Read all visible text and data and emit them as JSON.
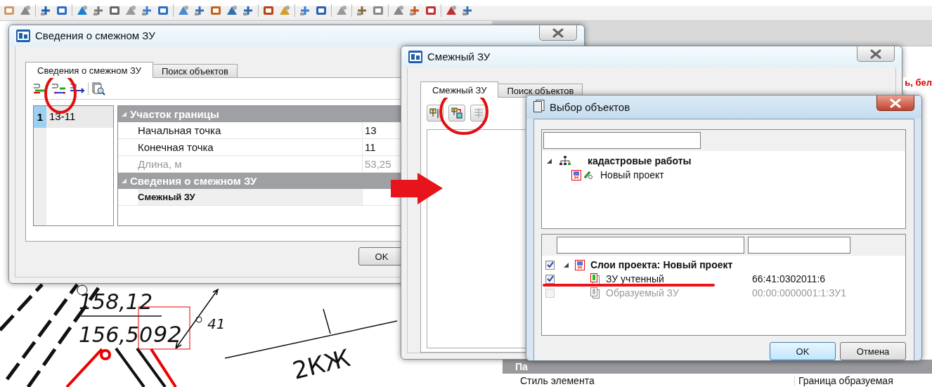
{
  "canvas": {
    "labels": [
      {
        "text": "158,12"
      },
      {
        "text": "156,50"
      },
      {
        "text": "92"
      },
      {
        "text": "41"
      },
      {
        "text": "2КЖ"
      }
    ]
  },
  "side_panel": {
    "warning": "ь, бел",
    "section_title": "Па",
    "property_name": "Стиль элемента",
    "property_value": "Граница образуемая"
  },
  "boundary_window": {
    "title": "Сведения о смежном ЗУ",
    "tabs": [
      {
        "label": "Сведения о смежном ЗУ",
        "selected": true
      },
      {
        "label": "Поиск объектов",
        "selected": false
      }
    ],
    "segments": [
      {
        "index": "1",
        "name": "13-11",
        "selected": true
      }
    ],
    "groups": [
      {
        "title": "Участок границы",
        "expanded": true,
        "rows": [
          {
            "label": "Начальная точка",
            "value": "13",
            "disabled": false,
            "bold": false
          },
          {
            "label": "Конечная точка",
            "value": "11",
            "disabled": false,
            "bold": false
          },
          {
            "label": "Длина, м",
            "value": "53,25",
            "disabled": true,
            "bold": false
          }
        ]
      },
      {
        "title": "Сведения о смежном ЗУ",
        "expanded": true,
        "rows": [
          {
            "label": "Смежный ЗУ",
            "disabled": false,
            "bold": true
          }
        ]
      }
    ],
    "ok_button": "OK"
  },
  "parcel_window": {
    "title": "Смежный ЗУ",
    "tabs": [
      {
        "label": "Смежный ЗУ",
        "selected": true
      },
      {
        "label": "Поиск объектов",
        "selected": false
      }
    ]
  },
  "picker_window": {
    "title": "Выбор объектов",
    "tree": [
      {
        "label": "кадастровые работы",
        "expanded": true,
        "children": [
          {
            "label": "Новый проект"
          }
        ]
      }
    ],
    "layers": [
      {
        "label": "Слои проекта: Новый проект",
        "checked": true,
        "disabled": false,
        "expanded": true,
        "children": [
          {
            "label": "ЗУ учтенный",
            "number": "66:41:0302011:6",
            "checked": true,
            "disabled": false
          },
          {
            "label": "Образуемый ЗУ",
            "number": "00:00:0000001:1:ЗУ1",
            "checked": false,
            "disabled": true
          }
        ]
      }
    ],
    "buttons": [
      {
        "label": "OK",
        "default": true
      },
      {
        "label": "Отмена",
        "default": false
      }
    ]
  }
}
